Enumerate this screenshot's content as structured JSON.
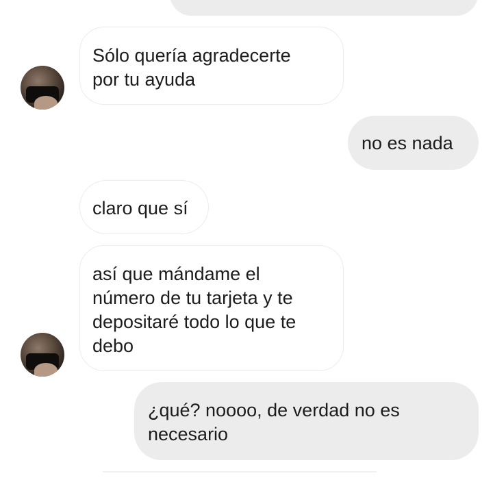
{
  "messages": [
    {
      "side": "outgoing",
      "text": ""
    },
    {
      "side": "incoming",
      "text": "Sólo quería agradecerte\npor tu ayuda"
    },
    {
      "side": "outgoing",
      "text": "no es nada"
    },
    {
      "side": "incoming",
      "text": "claro que sí"
    },
    {
      "side": "incoming",
      "text": "así que mándame el\nnúmero de tu tarjeta y te\ndepositaré todo lo que te\ndebo"
    },
    {
      "side": "outgoing",
      "text": "¿qué? noooo, de verdad no es\nnecesario"
    }
  ],
  "colors": {
    "outgoing_bubble": "#ececec",
    "incoming_border": "#ececec",
    "text": "#1c1c1c"
  }
}
